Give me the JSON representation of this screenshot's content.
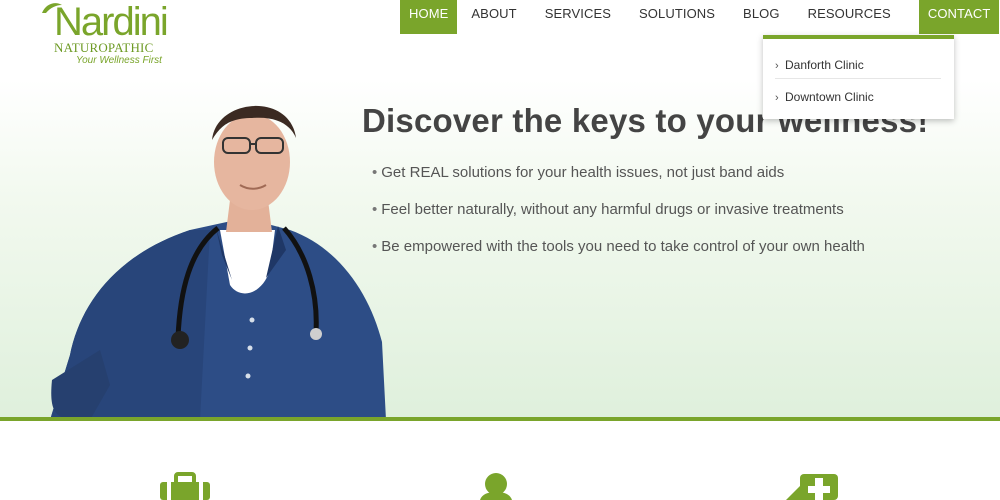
{
  "brand": {
    "name": "Nardini",
    "subtitle": "NATUROPATHIC",
    "tagline": "Your Wellness First",
    "color": "#7aa52b"
  },
  "nav": {
    "items": [
      {
        "label": "HOME",
        "active": true
      },
      {
        "label": "ABOUT"
      },
      {
        "label": "SERVICES"
      },
      {
        "label": "SOLUTIONS"
      },
      {
        "label": "BLOG"
      },
      {
        "label": "RESOURCES"
      },
      {
        "label": "CONTACT",
        "highlighted": true
      }
    ],
    "dropdown": [
      {
        "label": "Danforth Clinic"
      },
      {
        "label": "Downtown Clinic"
      }
    ]
  },
  "hero": {
    "title": "Discover the keys to your wellness!",
    "bullets": [
      "Get REAL solutions for your health issues, not just band aids",
      "Feel better naturally, without any harmful drugs or invasive treatments",
      "Be empowered with the tools you need to take control of your own health"
    ]
  },
  "features": {
    "icons": [
      "medical-kit-icon",
      "person-icon",
      "medical-cross-icon"
    ]
  }
}
